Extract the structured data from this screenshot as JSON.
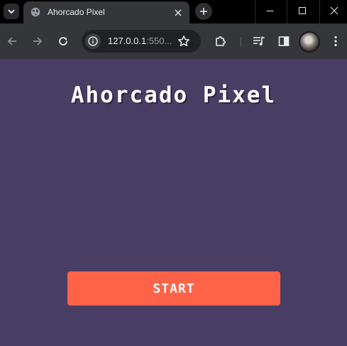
{
  "browser": {
    "tab": {
      "title": "Ahorcado Pixel",
      "favicon": "globe-icon"
    },
    "address_bar": {
      "url_host": "127.0.0.1",
      "url_rest": ":550..."
    },
    "icons": [
      "tab-search-icon",
      "close-icon",
      "plus-icon",
      "minimize-icon",
      "maximize-icon",
      "window-close-icon",
      "back-icon",
      "forward-icon",
      "reload-icon",
      "info-icon",
      "star-icon",
      "extensions-icon",
      "media-controls-icon",
      "side-panel-icon",
      "profile-avatar",
      "more-menu-icon"
    ],
    "colors": {
      "frame": "#000000",
      "toolbar": "#35363a",
      "omnibox": "#202124"
    }
  },
  "page": {
    "title": "Ahorcado Pixel",
    "start_label": "START",
    "colors": {
      "background": "#483d63",
      "button": "#ff6347",
      "text": "#ffffff"
    }
  }
}
